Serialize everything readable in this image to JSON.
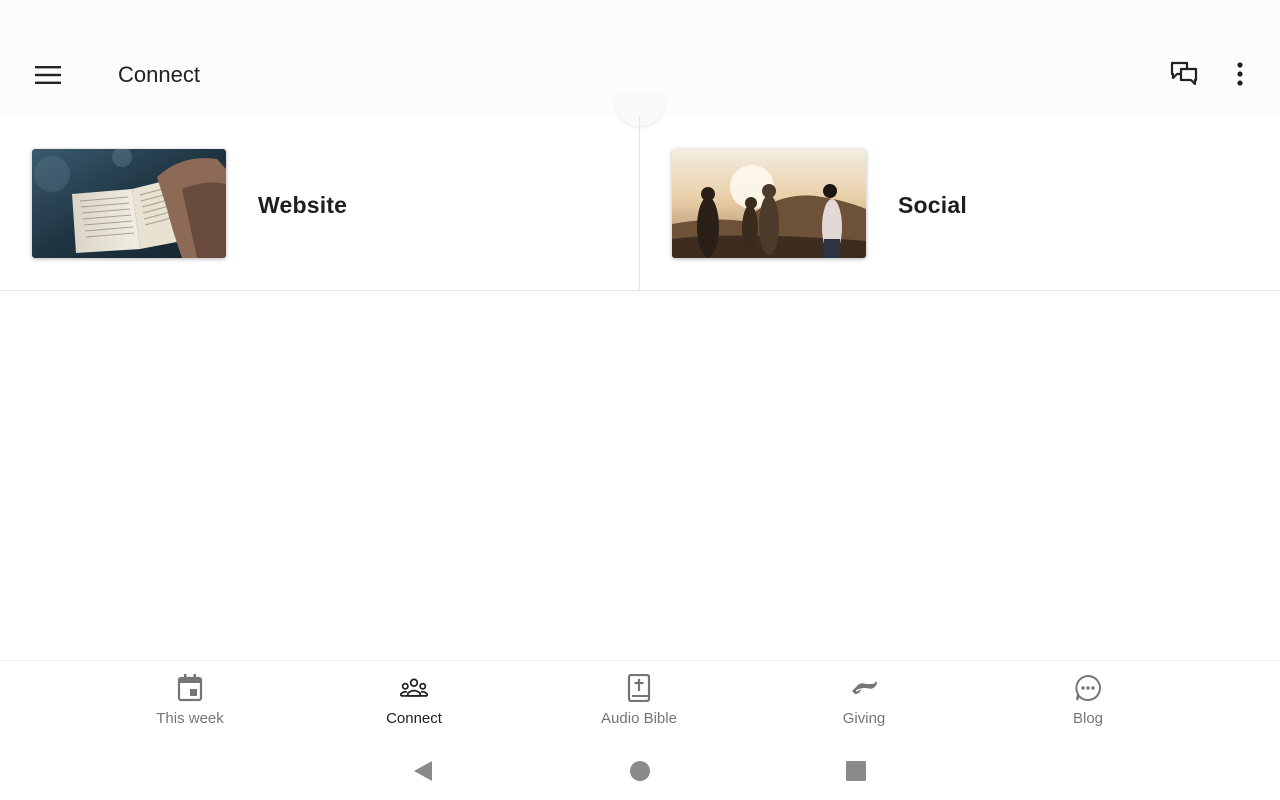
{
  "app_bar": {
    "title": "Connect",
    "menu_icon": "hamburger-menu-icon",
    "chat_icon": "chat-bubbles-icon",
    "more_icon": "more-vertical-icon"
  },
  "tiles": [
    {
      "label": "Website",
      "image": "bible-reading-photo"
    },
    {
      "label": "Social",
      "image": "friends-sunset-photo"
    }
  ],
  "bottom_nav": {
    "items": [
      {
        "label": "This week",
        "icon": "calendar-icon",
        "active": false
      },
      {
        "label": "Connect",
        "icon": "people-group-icon",
        "active": true
      },
      {
        "label": "Audio Bible",
        "icon": "bible-icon",
        "active": false
      },
      {
        "label": "Giving",
        "icon": "giving-hand-icon",
        "active": false
      },
      {
        "label": "Blog",
        "icon": "chat-bubble-dots-icon",
        "active": false
      }
    ]
  },
  "system_nav": {
    "back_icon": "back-triangle-icon",
    "home_icon": "home-circle-icon",
    "recents_icon": "recents-square-icon"
  },
  "colors": {
    "text_primary": "#212121",
    "nav_inactive": "#757575",
    "divider": "#e4e4e4"
  }
}
